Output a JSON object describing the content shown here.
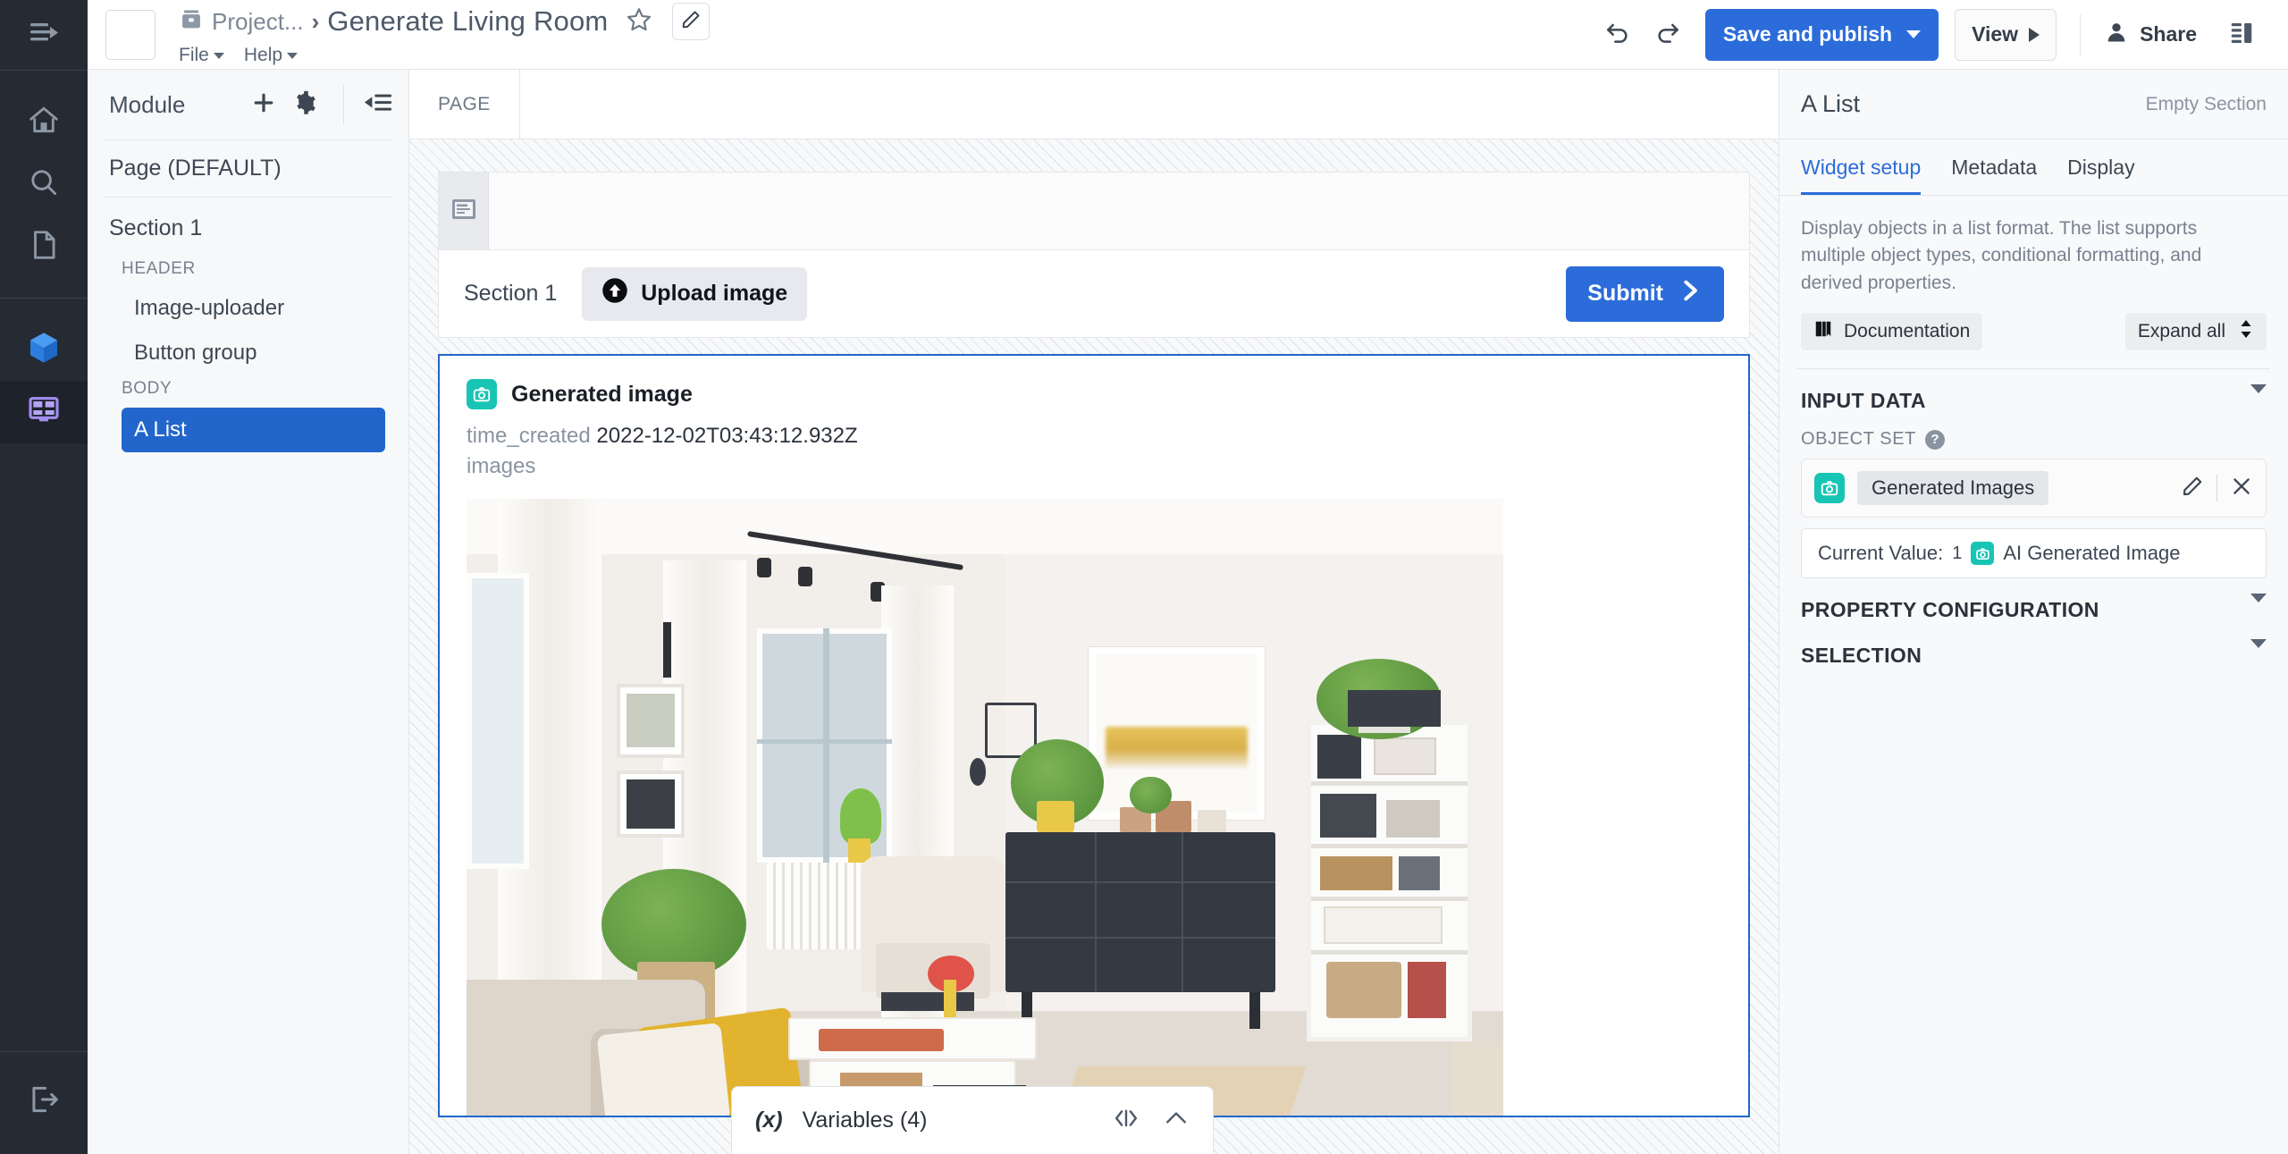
{
  "topbar": {
    "breadcrumb_project": "Project...",
    "breadcrumb_sep": "›",
    "title": "Generate Living Room",
    "menus": [
      {
        "label": "File"
      },
      {
        "label": "Help"
      }
    ],
    "save_label": "Save and publish",
    "view_label": "View",
    "share_label": "Share",
    "icons": {
      "collapse": "collapse-sidebar-icon",
      "undo": "undo-icon",
      "redo": "redo-icon",
      "star": "star-icon",
      "pencil": "pencil-edit-icon",
      "share_person": "person-icon",
      "panel_layout": "panel-layout-icon"
    }
  },
  "rail": {
    "items": [
      {
        "name": "expand-rail-icon"
      },
      {
        "name": "home-icon"
      },
      {
        "name": "search-icon"
      },
      {
        "name": "document-icon"
      },
      {
        "name": "cube-icon"
      },
      {
        "name": "dashboard-icon",
        "active": true
      },
      {
        "name": "logout-icon"
      }
    ]
  },
  "module_panel": {
    "title": "Module",
    "add_icon": "plus-icon",
    "settings_icon": "gear-icon",
    "collapse_icon": "collapse-list-icon",
    "page_label": "Page (DEFAULT)",
    "tree": {
      "section": "Section 1",
      "groups": [
        {
          "label": "HEADER",
          "items": [
            "Image-uploader",
            "Button group"
          ]
        },
        {
          "label": "BODY",
          "items": [
            "A List"
          ]
        }
      ],
      "selected": "A List"
    }
  },
  "canvas": {
    "tabs": [
      {
        "label": "PAGE"
      }
    ],
    "widget_handle_icon": "card-widget-icon",
    "section_label": "Section 1",
    "upload_button": "Upload image",
    "upload_icon": "upload-arrow-icon",
    "submit_button": "Submit",
    "submit_icon": "arrow-right-icon",
    "list_card": {
      "object_icon": "camera-object-icon",
      "title": "Generated image",
      "property_key": "time_created",
      "property_value": "2022-12-02T03:43:12.932Z",
      "property_key2": "images",
      "image_alt": "AI generated Scandinavian living room with white curtains, track lighting, dark dresser, white shelving, plants, beige sofa with yellow throw and white coffee table"
    }
  },
  "variables_bar": {
    "fx_label": "(x)",
    "label": "Variables (4)",
    "code_icon": "code-brackets-icon",
    "chevron_icon": "chevron-up-icon"
  },
  "inspector": {
    "title": "A List",
    "subtitle": "Empty Section",
    "tabs": [
      {
        "label": "Widget setup",
        "active": true
      },
      {
        "label": "Metadata",
        "active": false
      },
      {
        "label": "Display",
        "active": false
      }
    ],
    "description": "Display objects in a list format. The list supports multiple object types, conditional formatting, and derived properties.",
    "documentation_label": "Documentation",
    "documentation_icon": "book-icon",
    "expand_all_label": "Expand all",
    "expand_icon": "sort-updown-icon",
    "sections": [
      {
        "label": "INPUT DATA"
      },
      {
        "label": "PROPERTY CONFIGURATION"
      },
      {
        "label": "SELECTION"
      }
    ],
    "object_set": {
      "label": "OBJECT SET",
      "help_icon": "help-circle-icon",
      "chip_icon": "camera-object-icon",
      "value": "Generated Images",
      "edit_icon": "pencil-edit-icon",
      "remove_icon": "close-x-icon"
    },
    "current_value": {
      "label": "Current Value:",
      "count": "1",
      "chip_icon": "camera-object-icon",
      "text": "AI Generated Image"
    }
  },
  "colors": {
    "accent_blue": "#2b6cda",
    "select_blue": "#2266cc",
    "teal_object": "#18c5b4",
    "rail_bg": "#252a33",
    "panel_bg": "#f7f8f9"
  }
}
